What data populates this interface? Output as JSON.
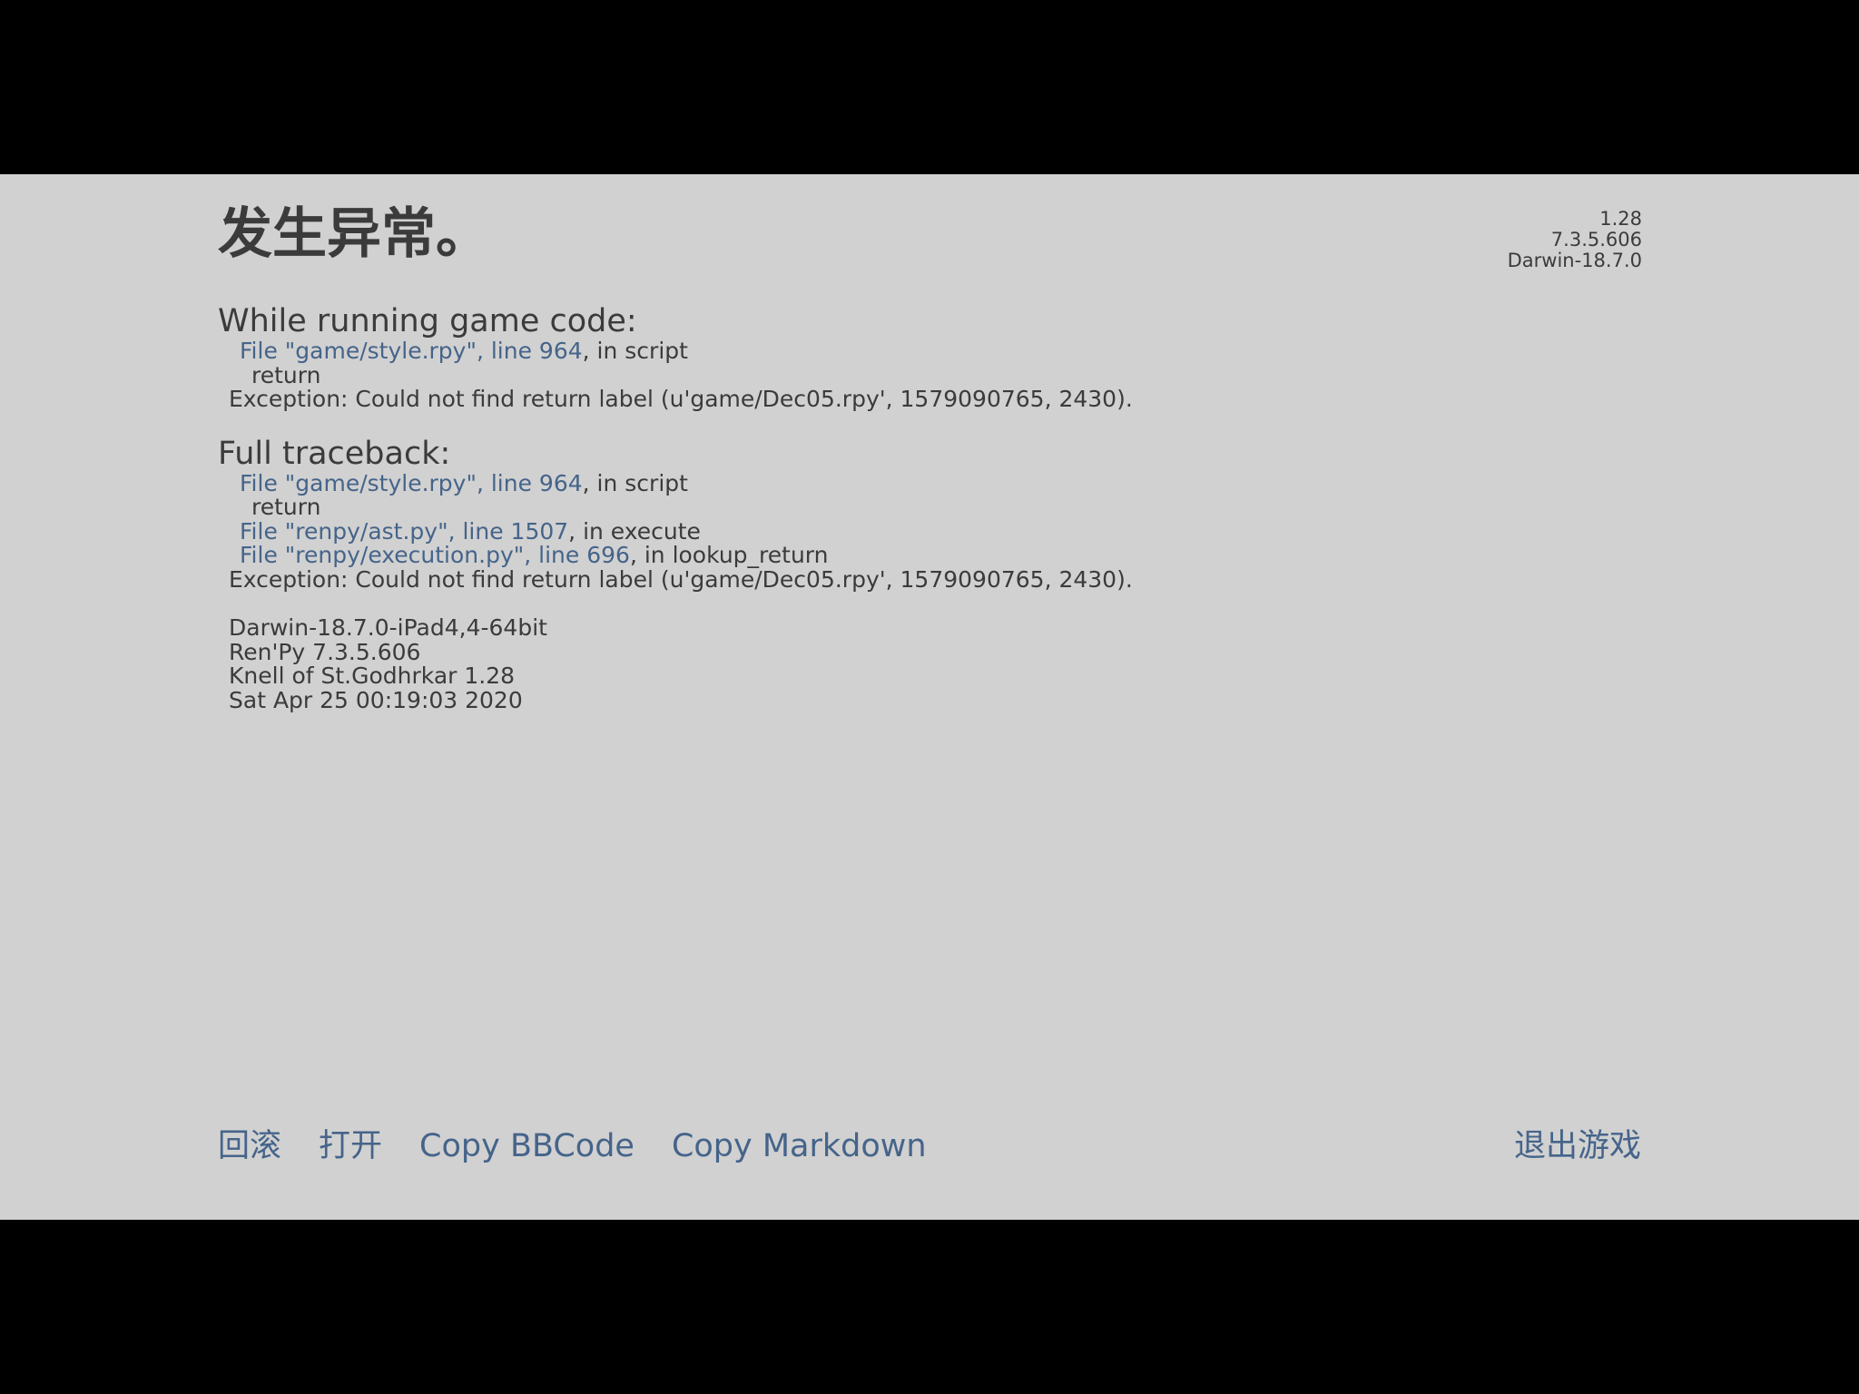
{
  "title": "发生异常。",
  "version_info": [
    "1.28",
    "7.3.5.606",
    "Darwin-18.7.0"
  ],
  "running_section": {
    "heading": "While running game code:",
    "lines": [
      {
        "type": "file",
        "link": "File \"game/style.rpy\", line 964",
        "suffix": ", in script"
      },
      {
        "type": "code",
        "text": "return"
      },
      {
        "type": "exception",
        "text": "Exception: Could not find return label (u'game/Dec05.rpy', 1579090765, 2430)."
      }
    ]
  },
  "traceback_section": {
    "heading": "Full traceback:",
    "lines": [
      {
        "type": "file",
        "link": "File \"game/style.rpy\", line 964",
        "suffix": ", in script"
      },
      {
        "type": "code",
        "text": "return"
      },
      {
        "type": "file",
        "link": "File \"renpy/ast.py\", line 1507",
        "suffix": ", in execute"
      },
      {
        "type": "file",
        "link": "File \"renpy/execution.py\", line 696",
        "suffix": ", in lookup_return"
      },
      {
        "type": "exception",
        "text": "Exception: Could not find return label (u'game/Dec05.rpy', 1579090765, 2430)."
      }
    ]
  },
  "system_info": [
    "Darwin-18.7.0-iPad4,4-64bit",
    "Ren'Py 7.3.5.606",
    "Knell of St.Godhrkar 1.28",
    "Sat Apr 25 00:19:03 2020"
  ],
  "buttons": {
    "rollback": "回滚",
    "open": "打开",
    "copy_bbcode": "Copy BBCode",
    "copy_markdown": "Copy Markdown",
    "quit": "退出游戏"
  },
  "colors": {
    "background": "#d1d1d1",
    "text": "#3b3b3b",
    "link": "#45648a",
    "letterbox": "#000000"
  }
}
